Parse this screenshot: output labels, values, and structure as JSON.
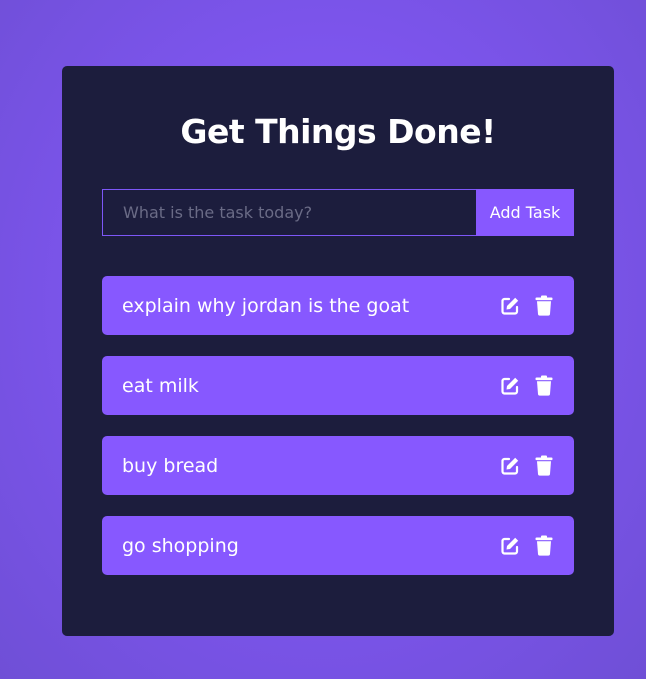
{
  "app": {
    "title": "Get Things Done!"
  },
  "form": {
    "placeholder": "What is the task today?",
    "value": "",
    "add_label": "Add Task"
  },
  "todos": [
    {
      "text": "explain why jordan is the goat",
      "edit_icon": "edit-icon",
      "delete_icon": "trash-icon"
    },
    {
      "text": "eat milk",
      "edit_icon": "edit-icon",
      "delete_icon": "trash-icon"
    },
    {
      "text": "buy bread",
      "edit_icon": "edit-icon",
      "delete_icon": "trash-icon"
    },
    {
      "text": "go shopping",
      "edit_icon": "edit-icon",
      "delete_icon": "trash-icon"
    }
  ],
  "colors": {
    "background": "#8758ff",
    "card": "#1c1d3d",
    "accent": "#8758ff",
    "text": "#ffffff",
    "placeholder": "#6a6b86"
  }
}
